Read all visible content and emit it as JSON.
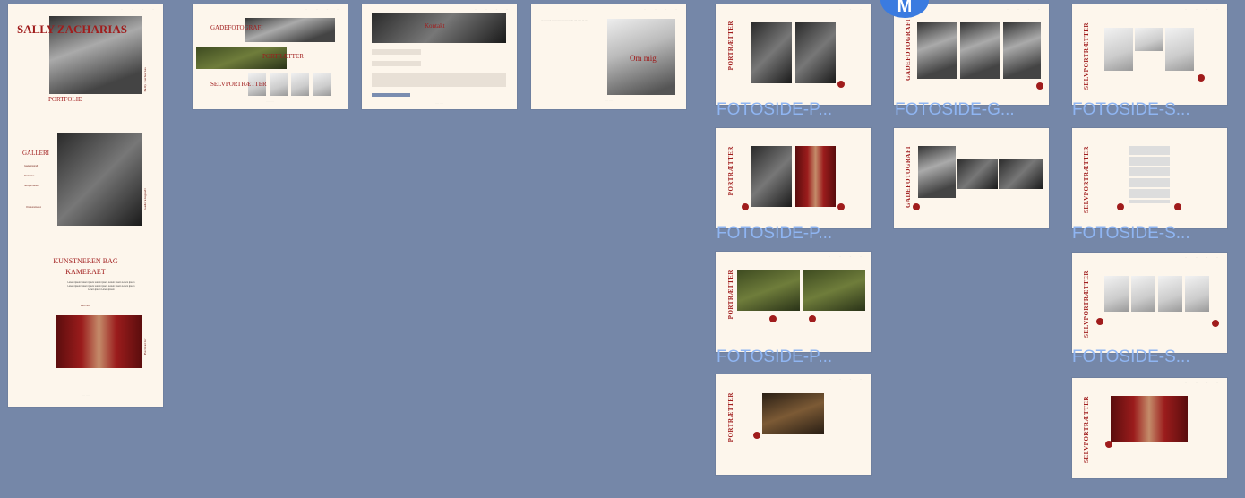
{
  "avatar": {
    "initial": "M"
  },
  "frames": {
    "home": {
      "title": "SALLY ZACHARIAS",
      "portfolio": "PORTFOLIE",
      "galleri": "GALLERI",
      "galleri_links": [
        "Gadefotografi",
        "Portrætter",
        "Selvportrætter"
      ],
      "about_link": "Om kunstneren",
      "artist_heading_1": "KUNSTNEREN BAG",
      "artist_heading_2": "KAMERAET",
      "lorem": "Lorem ipsum Lorem ipsum Lorem ipsum Lorem ipsum Lorem ipsum Lorem ipsum Lorem ipsum Lorem ipsum Lorem ipsum Lorem ipsum Lorem ipsum Lorem ipsum",
      "more": "Læs mere",
      "side_1": "Sally Zacharias",
      "side_2": "Gadefotografi",
      "side_3": "Portrætter"
    },
    "gallery": {
      "gadefotografi": "GADEFOTOGRAFI",
      "portraetter": "PORTRÆTTER",
      "selvportraetter": "SELVPORTRÆTTER"
    },
    "kontakt": {
      "title": "Kontakt"
    },
    "om_mig": {
      "title": "Om mig"
    },
    "pages": {
      "portraetter": "PORTRÆTTER",
      "gadefotografi": "GADEFOTOGRAFI",
      "selvportraetter": "SELVPORTRÆTTER"
    },
    "labels": {
      "p": "FOTOSIDE-P...",
      "g": "FOTOSIDE-G...",
      "s": "FOTOSIDE-S..."
    }
  }
}
